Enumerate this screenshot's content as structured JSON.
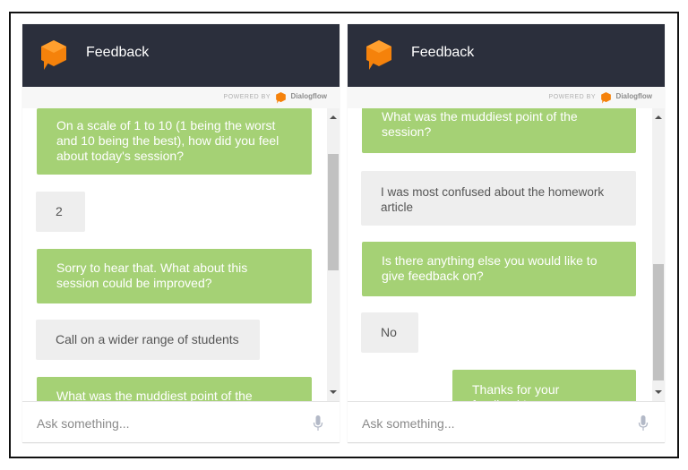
{
  "panels": [
    {
      "header": {
        "title": "Feedback",
        "logo_icon": "dialogflow-agent-logo"
      },
      "powered_by": {
        "label": "POWERED BY",
        "brand": "Dialogflow"
      },
      "messages": [
        {
          "sender": "bot",
          "text": "On a scale of 1 to 10 (1 being the worst and 10 being the best), how did you feel about today's session?"
        },
        {
          "sender": "user",
          "text": "2"
        },
        {
          "sender": "bot",
          "text": "Sorry to hear that. What about this session could be improved?"
        },
        {
          "sender": "user",
          "text": "Call on a wider range of students"
        },
        {
          "sender": "bot",
          "text": "What was the muddiest point of the session?"
        }
      ],
      "input": {
        "placeholder": "Ask something...",
        "value": ""
      },
      "mic_icon": "microphone-icon"
    },
    {
      "header": {
        "title": "Feedback",
        "logo_icon": "dialogflow-agent-logo"
      },
      "powered_by": {
        "label": "POWERED BY",
        "brand": "Dialogflow"
      },
      "messages": [
        {
          "sender": "bot",
          "text": "What was the muddiest point of the session?"
        },
        {
          "sender": "user",
          "text": "I was most confused about the homework article"
        },
        {
          "sender": "bot",
          "text": "Is there anything else you would like to give feedback on?"
        },
        {
          "sender": "user",
          "text": "No"
        },
        {
          "sender": "bot",
          "text": "Thanks for your feedback!"
        }
      ],
      "input": {
        "placeholder": "Ask something...",
        "value": ""
      },
      "mic_icon": "microphone-icon"
    }
  ],
  "colors": {
    "header_bg": "#2b2f3c",
    "bot_bubble": "#a5d175",
    "user_bubble": "#eeeeee",
    "brand_orange": "#f5820b"
  }
}
